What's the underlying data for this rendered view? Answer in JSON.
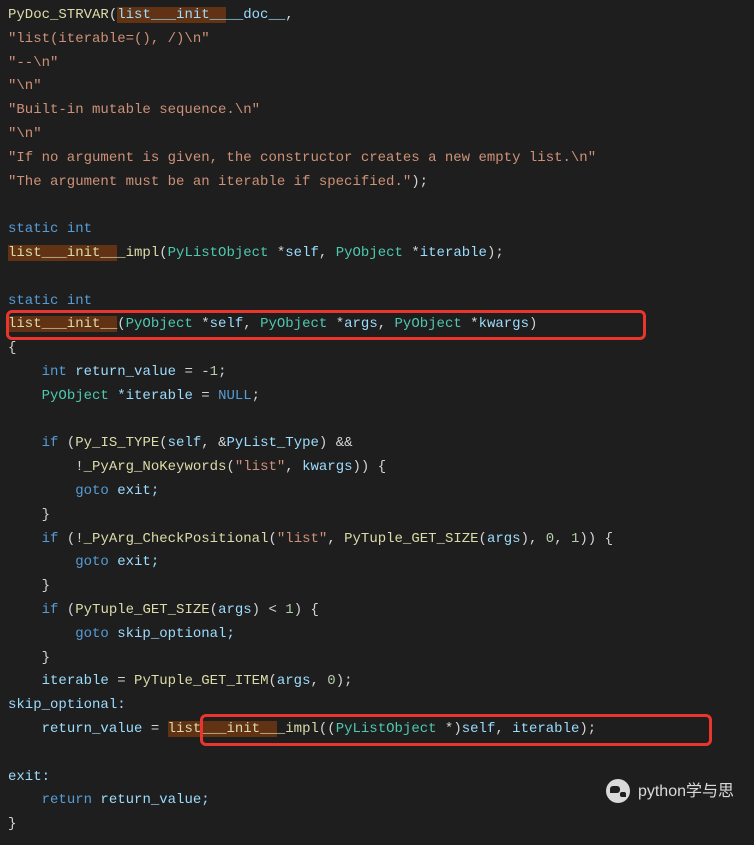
{
  "code": {
    "l1_func": "PyDoc_STRVAR",
    "l1_open": "(",
    "l1_hl": "list___init__",
    "l1_doc": "__doc__",
    "l1_comma": ",",
    "l2": "\"list(iterable=(), /)\\n\"",
    "l3": "\"--\\n\"",
    "l4": "\"\\n\"",
    "l5": "\"Built-in mutable sequence.\\n\"",
    "l6": "\"\\n\"",
    "l7": "\"If no argument is given, the constructor creates a new empty list.\\n\"",
    "l8a": "\"The argument must be an iterable if specified.\"",
    "l8b": ");",
    "l10_static": "static",
    "l10_int": " int",
    "l11_hl": "list___init__",
    "l11_impl": "_impl",
    "l11_open": "(",
    "l11_t1": "PyListObject",
    "l11_p1": " *",
    "l11_n1": "self",
    "l11_c1": ", ",
    "l11_t2": "PyObject",
    "l11_p2": " *",
    "l11_n2": "iterable",
    "l11_close": ");",
    "l13_static": "static",
    "l13_int": " int",
    "l14_hl": "list___init__",
    "l14_open": "(",
    "l14_t1": "PyObject",
    "l14_p1": " *",
    "l14_n1": "self",
    "l14_c1": ", ",
    "l14_t2": "PyObject",
    "l14_p2": " *",
    "l14_n2": "args",
    "l14_c2": ", ",
    "l14_t3": "PyObject",
    "l14_p3": " *",
    "l14_n3": "kwargs",
    "l14_close": ")",
    "l15": "{",
    "l16_type": "int",
    "l16_name": " return_value",
    "l16_eq": " = ",
    "l16_neg": "-",
    "l16_num": "1",
    "l16_end": ";",
    "l17_type": "PyObject",
    "l17_name": " *iterable",
    "l17_eq": " = ",
    "l17_null": "NULL",
    "l17_end": ";",
    "l19_if": "if",
    "l19_open": " (",
    "l19_func": "Py_IS_TYPE",
    "l19_popen": "(",
    "l19_self": "self",
    "l19_c": ", ",
    "l19_amp": "&",
    "l19_pylist": "PyList_Type",
    "l19_pclose": ")",
    "l19_and": " &&",
    "l20_neg": "!",
    "l20_func": "_PyArg_NoKeywords",
    "l20_popen": "(",
    "l20_str": "\"list\"",
    "l20_c": ", ",
    "l20_kwargs": "kwargs",
    "l20_pclose": ")) {",
    "l21_goto": "goto",
    "l21_exit": " exit;",
    "l22": "}",
    "l23_if": "if",
    "l23_open": " (!",
    "l23_func": "_PyArg_CheckPositional",
    "l23_popen": "(",
    "l23_str": "\"list\"",
    "l23_c1": ", ",
    "l23_func2": "PyTuple_GET_SIZE",
    "l23_popen2": "(",
    "l23_args": "args",
    "l23_pclose2": ")",
    "l23_c2": ", ",
    "l23_n0": "0",
    "l23_c3": ", ",
    "l23_n1": "1",
    "l23_end": ")) {",
    "l24_goto": "goto",
    "l24_exit": " exit;",
    "l25": "}",
    "l26_if": "if",
    "l26_open": " (",
    "l26_func": "PyTuple_GET_SIZE",
    "l26_popen": "(",
    "l26_args": "args",
    "l26_pclose": ")",
    "l26_lt": " < ",
    "l26_n1": "1",
    "l26_end": ") {",
    "l27_goto": "goto",
    "l27_skip": " skip_optional;",
    "l28": "}",
    "l29_iter": "iterable",
    "l29_eq": " = ",
    "l29_func": "PyTuple_GET_ITEM",
    "l29_popen": "(",
    "l29_args": "args",
    "l29_c": ", ",
    "l29_n0": "0",
    "l29_end": ");",
    "l30": "skip_optional:",
    "l31_rv": "return_value",
    "l31_eq": " = ",
    "l31_hl": "list___init__",
    "l31_impl": "_impl",
    "l31_popen": "((",
    "l31_type": "PyListObject",
    "l31_ptr": " *)",
    "l31_self": "self",
    "l31_c": ", ",
    "l31_iter": "iterable",
    "l31_end": ");",
    "l33": "exit:",
    "l34_return": "return",
    "l34_rv": " return_value;",
    "l35": "}"
  },
  "watermark": {
    "text": "python学与思"
  }
}
